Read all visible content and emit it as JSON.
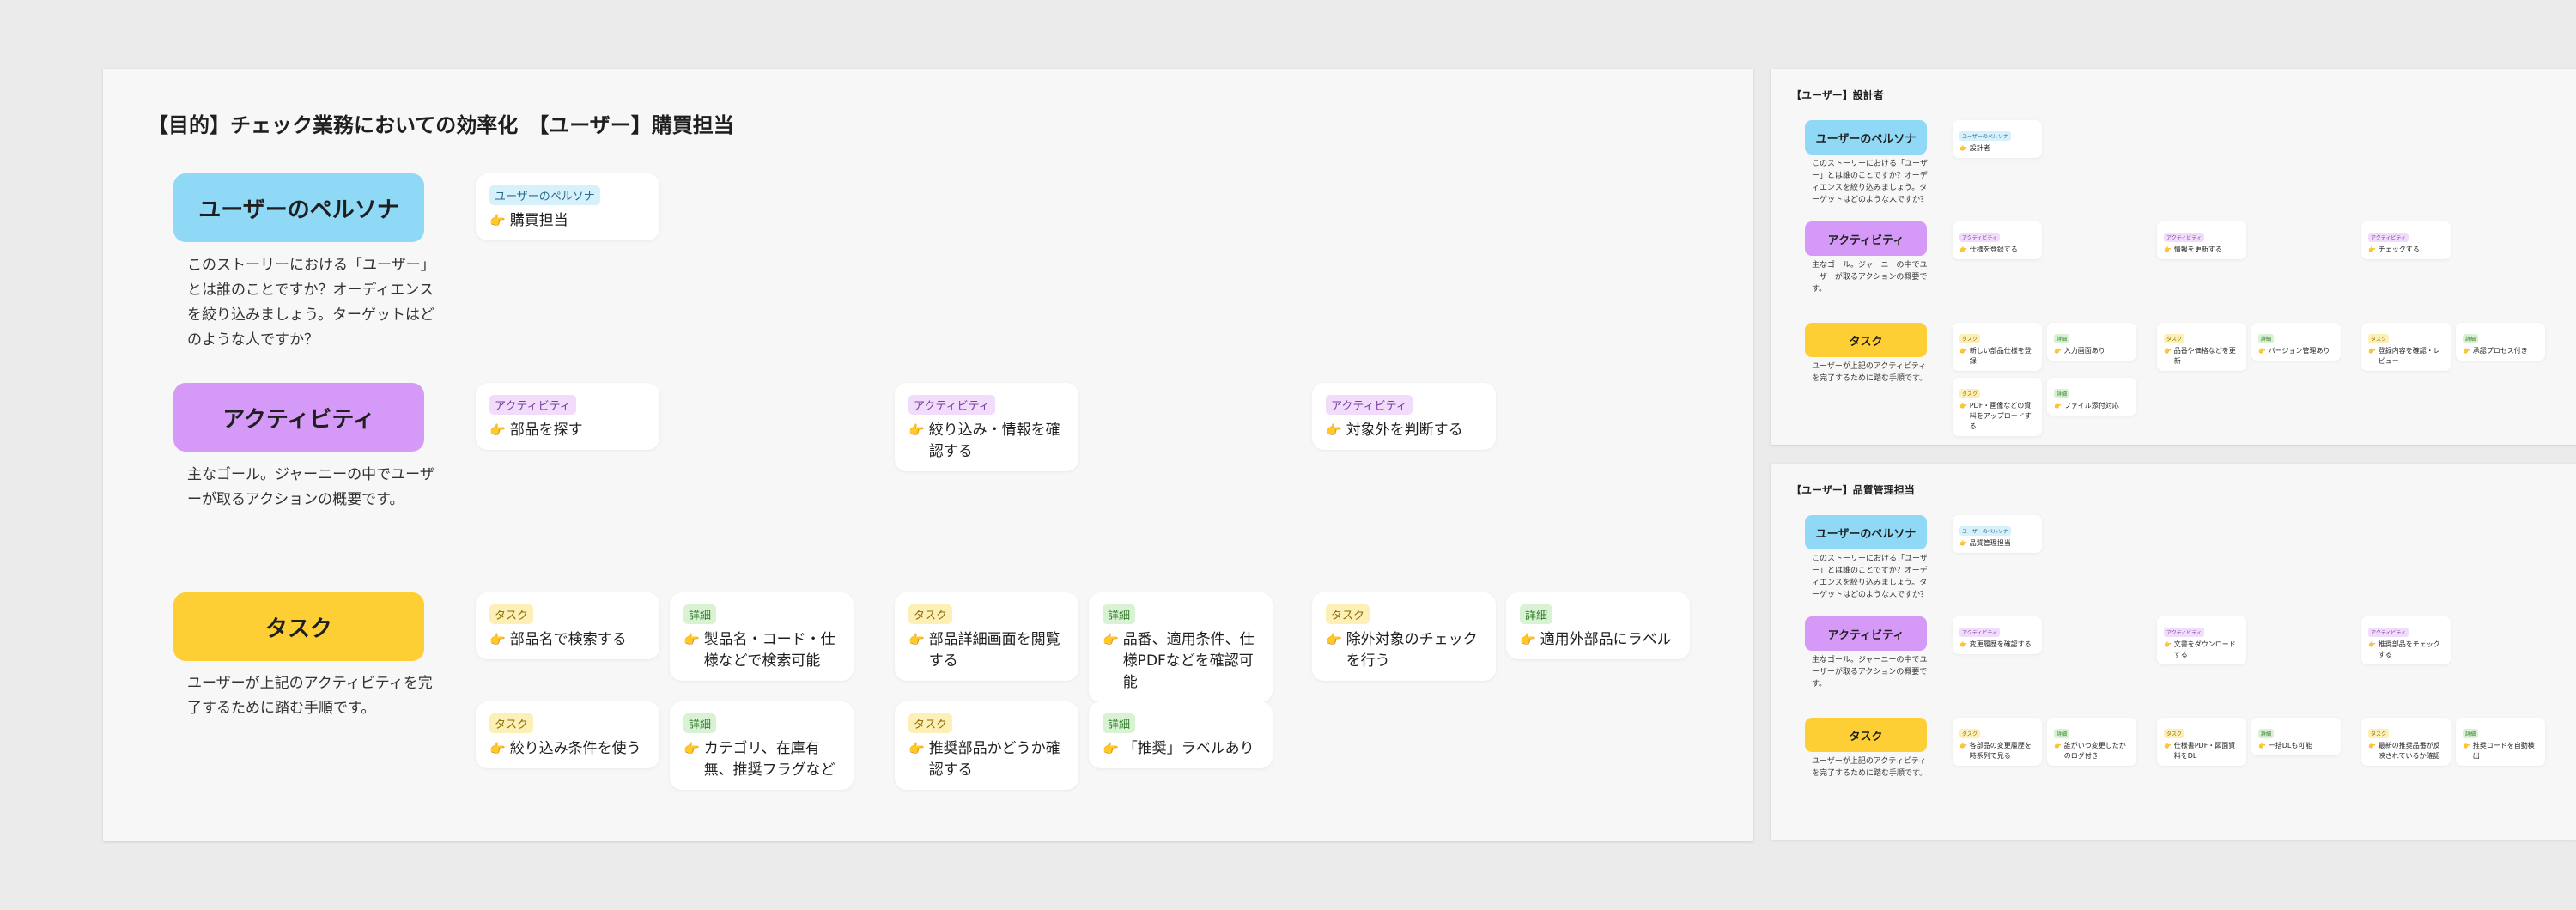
{
  "pointer_icon": "hand-pointing-right-icon",
  "colors": {
    "background": "#ebebeb",
    "persona": "#8fd9f7",
    "activity": "#d59af7",
    "task": "#fecf35"
  },
  "main": {
    "title": "【目的】チェック業務においての効率化　【ユーザー】購買担当",
    "rows": {
      "persona": {
        "label": "ユーザーのペルソナ",
        "desc": "このストーリーにおける「ユーザー」とは誰のことですか？オーディエンスを絞り込みましょう。ターゲットはどのような人ですか？"
      },
      "activity": {
        "label": "アクティビティ",
        "desc": "主なゴール。ジャーニーの中でユーザーが取るアクションの概要です。"
      },
      "task": {
        "label": "タスク",
        "desc": "ユーザーが上記のアクティビティを完了するために踏む手順です。"
      }
    },
    "cards": [
      {
        "tag": "ユーザーのペルソナ",
        "text": "購買担当"
      },
      {
        "tag": "アクティビティ",
        "text": "部品を探す"
      },
      {
        "tag": "アクティビティ",
        "text": "絞り込み・情報を確認する"
      },
      {
        "tag": "アクティビティ",
        "text": "対象外を判断する"
      },
      {
        "tag": "タスク",
        "text": "部品名で検索する"
      },
      {
        "tag": "詳細",
        "text": "製品名・コード・仕様などで検索可能"
      },
      {
        "tag": "タスク",
        "text": "部品詳細画面を閲覧する"
      },
      {
        "tag": "詳細",
        "text": "品番、適用条件、仕様PDFなどを確認可能"
      },
      {
        "tag": "タスク",
        "text": "除外対象のチェックを行う"
      },
      {
        "tag": "詳細",
        "text": "適用外部品にラベル"
      },
      {
        "tag": "タスク",
        "text": "絞り込み条件を使う"
      },
      {
        "tag": "詳細",
        "text": "カテゴリ、在庫有無、推奨フラグなど"
      },
      {
        "tag": "タスク",
        "text": "推奨部品かどうか確認する"
      },
      {
        "tag": "詳細",
        "text": "「推奨」ラベルあり"
      }
    ]
  },
  "designer": {
    "title": "【ユーザー】設計者",
    "rows": {
      "persona": {
        "label": "ユーザーのペルソナ",
        "desc": "このストーリーにおける「ユーザー」とは誰のことですか？オーディエンスを絞り込みましょう。ターゲットはどのような人ですか？"
      },
      "activity": {
        "label": "アクティビティ",
        "desc": "主なゴール。ジャーニーの中でユーザーが取るアクションの概要です。"
      },
      "task": {
        "label": "タスク",
        "desc": "ユーザーが上記のアクティビティを完了するために踏む手順です。"
      }
    },
    "cards": [
      {
        "tag": "ユーザーのペルソナ",
        "text": "設計者"
      },
      {
        "tag": "アクティビティ",
        "text": "仕様を登録する"
      },
      {
        "tag": "アクティビティ",
        "text": "情報を更新する"
      },
      {
        "tag": "アクティビティ",
        "text": "チェックする"
      },
      {
        "tag": "タスク",
        "text": "新しい部品仕様を登録"
      },
      {
        "tag": "詳細",
        "text": "入力画面あり"
      },
      {
        "tag": "タスク",
        "text": "品番や価格などを更新"
      },
      {
        "tag": "詳細",
        "text": "バージョン管理あり"
      },
      {
        "tag": "タスク",
        "text": "登録内容を確認・レビュー"
      },
      {
        "tag": "詳細",
        "text": "承認プロセス付き"
      },
      {
        "tag": "タスク",
        "text": "PDF・画像などの資料をアップロードする"
      },
      {
        "tag": "詳細",
        "text": "ファイル添付対応"
      }
    ]
  },
  "qa": {
    "title": "【ユーザー】品質管理担当",
    "rows": {
      "persona": {
        "label": "ユーザーのペルソナ",
        "desc": "このストーリーにおける「ユーザー」とは誰のことですか？オーディエンスを絞り込みましょう。ターゲットはどのような人ですか？"
      },
      "activity": {
        "label": "アクティビティ",
        "desc": "主なゴール。ジャーニーの中でユーザーが取るアクションの概要です。"
      },
      "task": {
        "label": "タスク",
        "desc": "ユーザーが上記のアクティビティを完了するために踏む手順です。"
      }
    },
    "cards": [
      {
        "tag": "ユーザーのペルソナ",
        "text": "品質管理担当"
      },
      {
        "tag": "アクティビティ",
        "text": "変更履歴を確認する"
      },
      {
        "tag": "アクティビティ",
        "text": "文書をダウンロードする"
      },
      {
        "tag": "アクティビティ",
        "text": "推奨部品をチェックする"
      },
      {
        "tag": "タスク",
        "text": "各部品の変更履歴を時系列で見る"
      },
      {
        "tag": "詳細",
        "text": "誰がいつ変更したかのログ付き"
      },
      {
        "tag": "タスク",
        "text": "仕様書PDF・図面資料をDL"
      },
      {
        "tag": "詳細",
        "text": "一括DLも可能"
      },
      {
        "tag": "タスク",
        "text": "最新の推奨品番が反映されているか確認"
      },
      {
        "tag": "詳細",
        "text": "推奨コードを自動検出"
      }
    ]
  }
}
